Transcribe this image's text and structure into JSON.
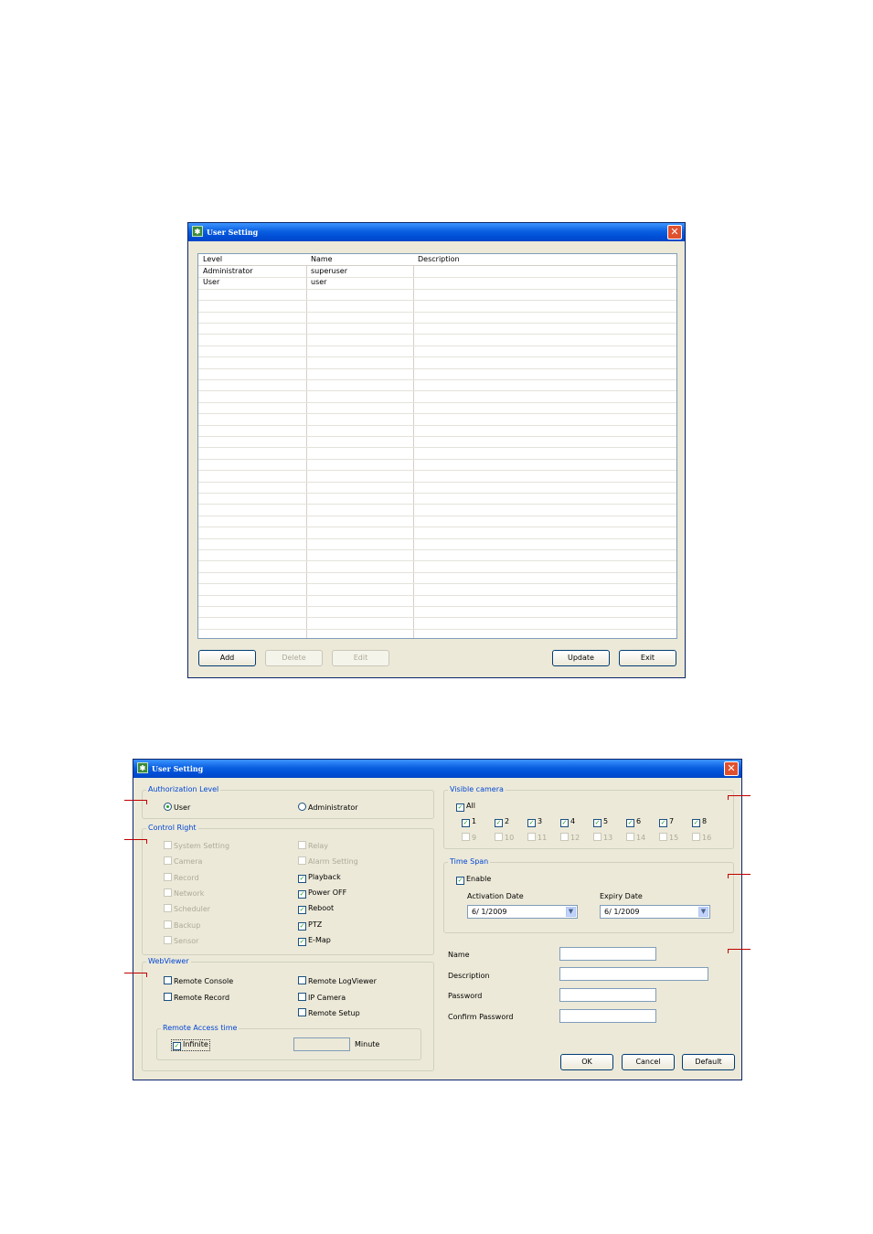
{
  "dialog1": {
    "title": "User Setting",
    "table": {
      "columns": [
        "Level",
        "Name",
        "Description"
      ],
      "rows": [
        {
          "level": "Administrator",
          "name": "superuser",
          "description": ""
        },
        {
          "level": "User",
          "name": "user",
          "description": ""
        }
      ]
    },
    "buttons": {
      "add": "Add",
      "delete": "Delete",
      "edit": "Edit",
      "update": "Update",
      "exit": "Exit"
    }
  },
  "dialog2": {
    "title": "User Setting",
    "authorization": {
      "legend": "Authorization Level",
      "user": "User",
      "administrator": "Administrator",
      "selected": "User"
    },
    "control_right": {
      "legend": "Control Right",
      "left": [
        {
          "label": "System Setting",
          "checked": false,
          "enabled": false
        },
        {
          "label": "Camera",
          "checked": false,
          "enabled": false
        },
        {
          "label": "Record",
          "checked": false,
          "enabled": false
        },
        {
          "label": "Network",
          "checked": false,
          "enabled": false
        },
        {
          "label": "Scheduler",
          "checked": false,
          "enabled": false
        },
        {
          "label": "Backup",
          "checked": false,
          "enabled": false
        },
        {
          "label": "Sensor",
          "checked": false,
          "enabled": false
        }
      ],
      "right": [
        {
          "label": "Relay",
          "checked": false,
          "enabled": false
        },
        {
          "label": "Alarm Setting",
          "checked": false,
          "enabled": false
        },
        {
          "label": "Playback",
          "checked": true,
          "enabled": true
        },
        {
          "label": "Power OFF",
          "checked": true,
          "enabled": true
        },
        {
          "label": "Reboot",
          "checked": true,
          "enabled": true
        },
        {
          "label": "PTZ",
          "checked": true,
          "enabled": true
        },
        {
          "label": "E-Map",
          "checked": true,
          "enabled": true
        }
      ]
    },
    "webviewer": {
      "legend": "WebViewer",
      "remote_console": "Remote Console",
      "remote_record": "Remote Record",
      "remote_logviewer": "Remote LogViewer",
      "ip_camera": "IP Camera",
      "remote_setup": "Remote Setup",
      "access_time": {
        "legend": "Remote Access time",
        "infinite": "Infinite",
        "minute": "Minute"
      }
    },
    "visible_camera": {
      "legend": "Visible camera",
      "all": "All",
      "cameras": [
        {
          "label": "1",
          "checked": true,
          "enabled": true
        },
        {
          "label": "2",
          "checked": true,
          "enabled": true
        },
        {
          "label": "3",
          "checked": true,
          "enabled": true
        },
        {
          "label": "4",
          "checked": true,
          "enabled": true
        },
        {
          "label": "5",
          "checked": true,
          "enabled": true
        },
        {
          "label": "6",
          "checked": true,
          "enabled": true
        },
        {
          "label": "7",
          "checked": true,
          "enabled": true
        },
        {
          "label": "8",
          "checked": true,
          "enabled": true
        },
        {
          "label": "9",
          "checked": false,
          "enabled": false
        },
        {
          "label": "10",
          "checked": false,
          "enabled": false
        },
        {
          "label": "11",
          "checked": false,
          "enabled": false
        },
        {
          "label": "12",
          "checked": false,
          "enabled": false
        },
        {
          "label": "13",
          "checked": false,
          "enabled": false
        },
        {
          "label": "14",
          "checked": false,
          "enabled": false
        },
        {
          "label": "15",
          "checked": false,
          "enabled": false
        },
        {
          "label": "16",
          "checked": false,
          "enabled": false
        }
      ]
    },
    "time_span": {
      "legend": "Time Span",
      "enable": "Enable",
      "activation_label": "Activation Date",
      "activation_value": "6/  1/2009",
      "expiry_label": "Expiry Date",
      "expiry_value": "6/  1/2009"
    },
    "account": {
      "name": "Name",
      "description": "Description",
      "password": "Password",
      "confirm_password": "Confirm Password"
    },
    "buttons": {
      "ok": "OK",
      "cancel": "Cancel",
      "default": "Default"
    }
  },
  "colors": {
    "titlebar": "#0054e3",
    "dialog_bg": "#ece9d8",
    "legend_text": "#0046d5",
    "callout": "#c00000",
    "check": "#21a121"
  }
}
